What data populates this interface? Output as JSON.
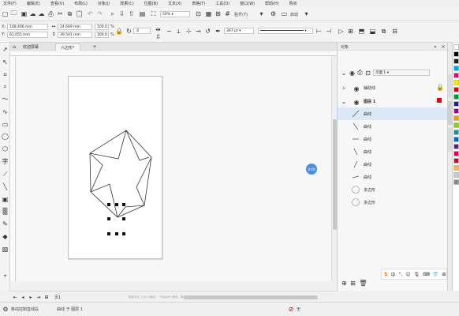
{
  "menubar": {
    "items": [
      "文件(F)",
      "编辑(E)",
      "查看(V)",
      "布局(L)",
      "对象(J)",
      "效果(C)",
      "位图(B)",
      "文本(X)",
      "表格(T)",
      "工具(O)",
      "窗口(W)",
      "帮助(H)",
      "购买"
    ]
  },
  "toolbar1": {
    "zoom_value": "50%",
    "snap_label": "贴齐(T)",
    "launch_label": "启动"
  },
  "toolbar2": {
    "x_label": "X:",
    "x_value": "108.406 mm",
    "y_label": "Y:",
    "y_value": "61.055 mm",
    "w_value": "24.669 mm",
    "h_value": "39.501 mm",
    "scale_x": "100.0",
    "scale_y": "100.0",
    "pct": "%",
    "rotate_value": ".0",
    "outline_width": "367 pt"
  },
  "tabs": {
    "welcome": "欢迎屏幕",
    "doc": "六边形*"
  },
  "canvas": {
    "fab_label": "0:00"
  },
  "pagebar": {
    "page_label": "页1",
    "hint": "拖动节点（Ctrl+拖动，一节点Alt+拖动；单击；按Shift+拖动可多选对象）"
  },
  "objpanel": {
    "title": "对象",
    "page_select": "页面 1",
    "rows": [
      {
        "name": "辅助线",
        "type": "layer"
      },
      {
        "name": "图层 1",
        "type": "layer"
      },
      {
        "name": "曲线",
        "type": "curve",
        "selected": true
      },
      {
        "name": "曲线",
        "type": "curve"
      },
      {
        "name": "曲线",
        "type": "curve"
      },
      {
        "name": "曲线",
        "type": "curve"
      },
      {
        "name": "曲线",
        "type": "curve"
      },
      {
        "name": "曲线",
        "type": "curve"
      },
      {
        "name": "多边形",
        "type": "polygon"
      },
      {
        "name": "多边形",
        "type": "polygon"
      }
    ]
  },
  "statusbar": {
    "tool_hint": "移动控制直线段",
    "object_info": "曲线 于 图层 1",
    "fill_none": "无"
  },
  "ime": {
    "label": "中"
  },
  "palette": {
    "colors": [
      "#ffffff",
      "#000000",
      "#1f1f1f",
      "#00a0e9",
      "#e4007f",
      "#fff100",
      "#e60012",
      "#00913a",
      "#1d2088",
      "#920783",
      "#f39800",
      "#8fc31f",
      "#009e96",
      "#0068b7",
      "#601986",
      "#e5004f",
      "#c30d23",
      "#f8b551",
      "#c9caca",
      "#898989"
    ]
  }
}
